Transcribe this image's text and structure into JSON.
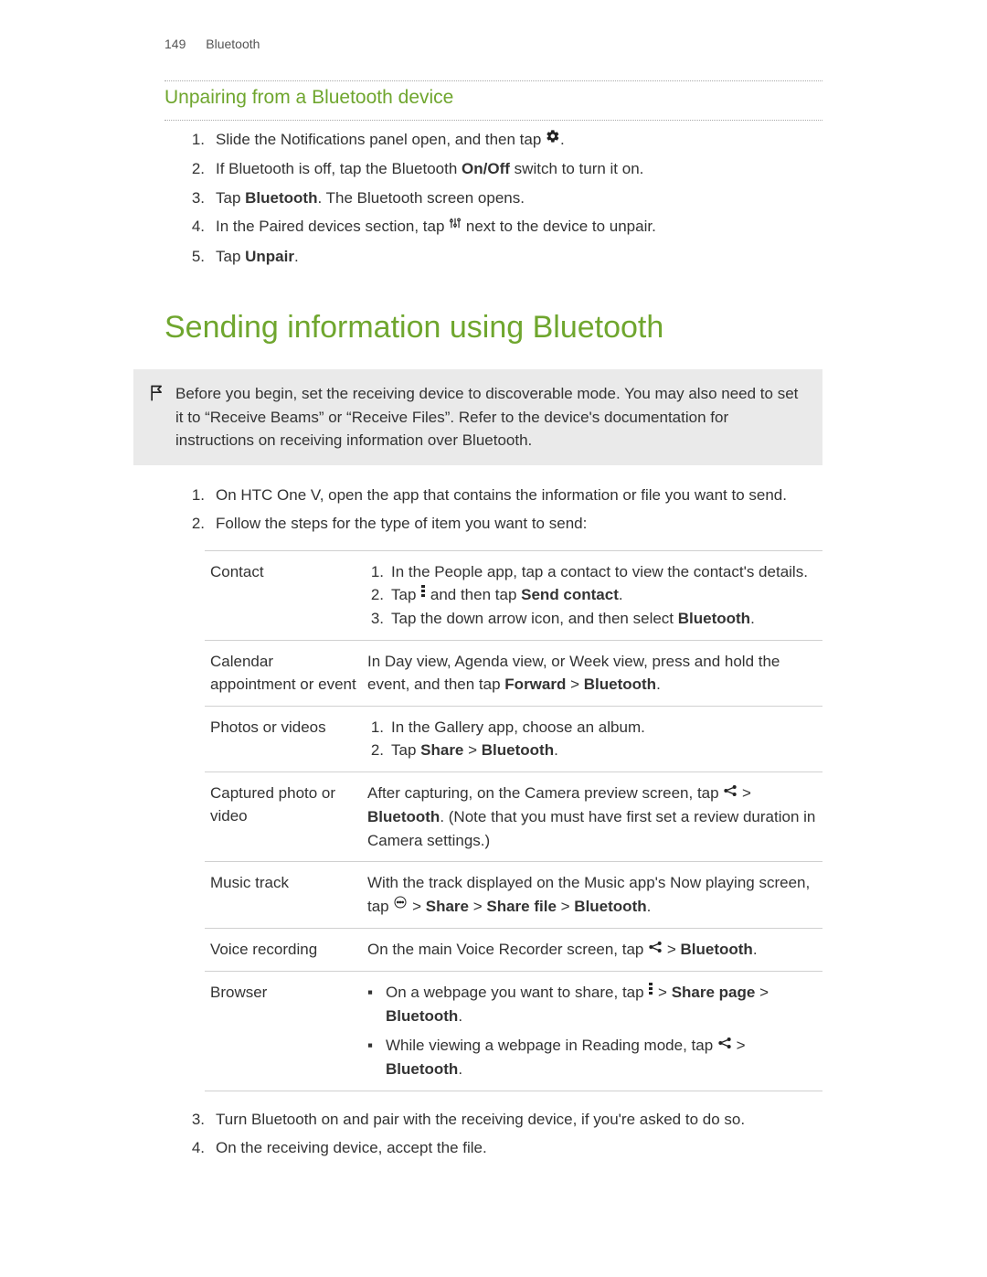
{
  "header": {
    "page_number": "149",
    "section": "Bluetooth"
  },
  "subsection_title": "Unpairing from a Bluetooth device",
  "unpair_steps": [
    {
      "n": "1.",
      "pre": "Slide the Notifications panel open, and then tap ",
      "icon": "gear",
      "post": "."
    },
    {
      "n": "2.",
      "pre": "If Bluetooth is off, tap the Bluetooth ",
      "bold1": "On/Off",
      "mid": " switch to turn it on."
    },
    {
      "n": "3.",
      "pre": "Tap ",
      "bold1": "Bluetooth",
      "mid": ". The Bluetooth screen opens."
    },
    {
      "n": "4.",
      "pre": "In the Paired devices section, tap ",
      "icon": "sliders",
      "post": " next to the device to unpair."
    },
    {
      "n": "5.",
      "pre": "Tap ",
      "bold1": "Unpair",
      "mid": "."
    }
  ],
  "section_title": "Sending information using Bluetooth",
  "note_text": "Before you begin, set the receiving device to discoverable mode. You may also need to set it to “Receive Beams” or “Receive Files”. Refer to the device's documentation for instructions on receiving information over Bluetooth.",
  "send_steps_top": [
    {
      "n": "1.",
      "text": "On HTC One V, open the app that contains the information or file you want to send."
    },
    {
      "n": "2.",
      "text": "Follow the steps for the type of item you want to send:"
    }
  ],
  "table_rows": {
    "contact": {
      "label": "Contact",
      "r1": "In the People app, tap a contact to view the contact's details.",
      "r2_pre": "Tap ",
      "r2_bold": "Send contact",
      "r2_post": ".",
      "r3_pre": "Tap the down arrow icon, and then select ",
      "r3_bold": "Bluetooth",
      "r3_post": "."
    },
    "calendar": {
      "label": "Calendar appointment or event",
      "pre": "In Day view, Agenda view, or Week view, press and hold the event, and then tap ",
      "bold1": "Forward",
      "mid": " > ",
      "bold2": "Bluetooth",
      "post": "."
    },
    "photos": {
      "label": "Photos or videos",
      "r1": "In the Gallery app, choose an album.",
      "r2_pre": "Tap ",
      "r2_bold1": "Share",
      "r2_mid": " > ",
      "r2_bold2": "Bluetooth",
      "r2_post": "."
    },
    "captured": {
      "label": "Captured photo or video",
      "pre": "After capturing, on the Camera preview screen, tap ",
      "mid1": " > ",
      "bold1": "Bluetooth",
      "mid2": ". (Note that you must have first set a review duration in Camera settings.)"
    },
    "music": {
      "label": "Music track",
      "pre": "With the track displayed on the Music app's Now playing screen, tap ",
      "mid1": " > ",
      "bold1": "Share",
      "mid2": " > ",
      "bold2": "Share file",
      "mid3": " > ",
      "bold3": "Bluetooth",
      "post": "."
    },
    "voice": {
      "label": "Voice recording",
      "pre": "On the main Voice Recorder screen, tap ",
      "mid1": " > ",
      "bold1": "Bluetooth",
      "post": "."
    },
    "browser": {
      "label": "Browser",
      "b1_pre": "On a webpage you want to share, tap ",
      "b1_mid1": " > ",
      "b1_bold1": "Share page",
      "b1_mid2": " > ",
      "b1_bold2": "Bluetooth",
      "b1_post": ".",
      "b2_pre": "While viewing a webpage in Reading mode, tap ",
      "b2_mid1": " > ",
      "b2_bold1": "Bluetooth",
      "b2_post": "."
    }
  },
  "send_steps_bottom": [
    {
      "n": "3.",
      "text": "Turn Bluetooth on and pair with the receiving device, if you're asked to do so."
    },
    {
      "n": "4.",
      "text": "On the receiving device, accept the file."
    }
  ],
  "nums": {
    "n1": "1.",
    "n2": "2.",
    "n3": "3."
  },
  "bullet": "▪",
  "r2_and_then": " and then tap "
}
